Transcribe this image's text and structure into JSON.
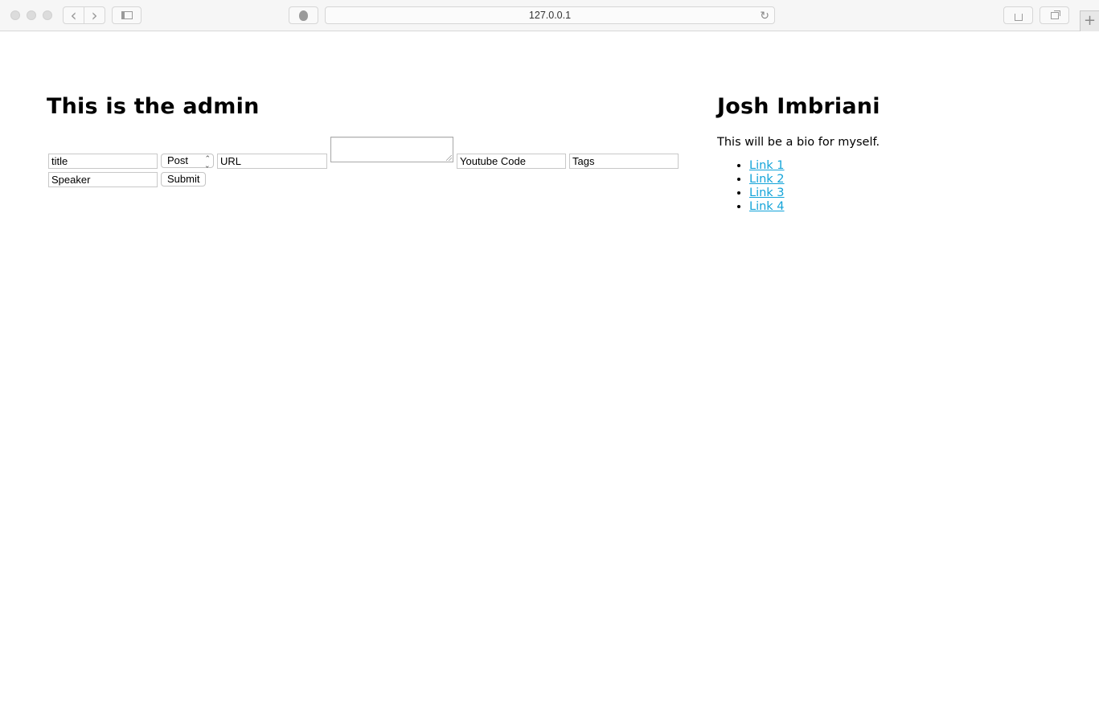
{
  "browser": {
    "address": "127.0.0.1",
    "icons": {
      "back": "chevron-left-icon",
      "forward": "chevron-right-icon",
      "sidebar": "sidebar-icon",
      "privacy": "hand-icon",
      "reload": "reload-icon",
      "share": "share-icon",
      "tabs": "tabs-icon",
      "new_tab": "plus-icon"
    },
    "glyphs": {
      "back": "‹",
      "forward": "›",
      "reload": "↻",
      "new_tab": "+",
      "share": "⇪",
      "tabs": "❐",
      "sidebar": "▯",
      "privacy": "✋"
    }
  },
  "main": {
    "heading": "This is the admin",
    "form": {
      "title_value": "title",
      "type_select": {
        "selected": "Post"
      },
      "url_value": "URL",
      "body_value": "",
      "youtube_value": "Youtube Code",
      "tags_value": "Tags",
      "speaker_value": "Speaker",
      "submit_label": "Submit"
    }
  },
  "sidebar": {
    "name": "Josh Imbriani",
    "bio": "This will be a bio for myself.",
    "links": [
      {
        "label": "Link 1"
      },
      {
        "label": "Link 2"
      },
      {
        "label": "Link 3"
      },
      {
        "label": "Link 4"
      }
    ],
    "link_color": "#12a3d9"
  }
}
